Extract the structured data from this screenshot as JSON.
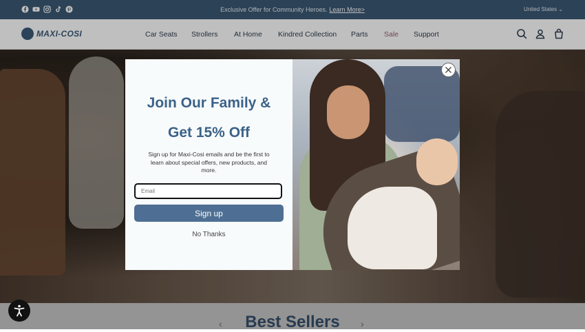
{
  "topbar": {
    "social_icons": [
      "facebook-icon",
      "youtube-icon",
      "instagram-icon",
      "tiktok-icon",
      "pinterest-icon"
    ],
    "announcement": "Exclusive Offer for Community Heroes.",
    "announcement_link": "Learn More>",
    "country": "United States ⌄"
  },
  "header": {
    "logo": "MAXI-COSI",
    "nav": [
      "Car Seats",
      "Strollers",
      "At Home",
      "Kindred Collection",
      "Parts",
      "Sale",
      "Support"
    ],
    "icons": [
      "search-icon",
      "account-icon",
      "cart-icon"
    ]
  },
  "section": {
    "title": "Best Sellers",
    "prev": "‹",
    "next": "›"
  },
  "popup": {
    "heading_line1": "Join Our Family &",
    "heading_line2": "Get 15% Off",
    "body": "Sign up for Maxi-Cosi emails and be the first to learn about special offers, new products, and more.",
    "email_placeholder": "Email",
    "signup_label": "Sign up",
    "no_thanks_label": "No Thanks"
  },
  "colors": {
    "topbar": "#3b5873",
    "brand": "#3b5a79",
    "heading": "#3b6288",
    "button": "#4e6f93",
    "sale": "#9b5a6b"
  }
}
